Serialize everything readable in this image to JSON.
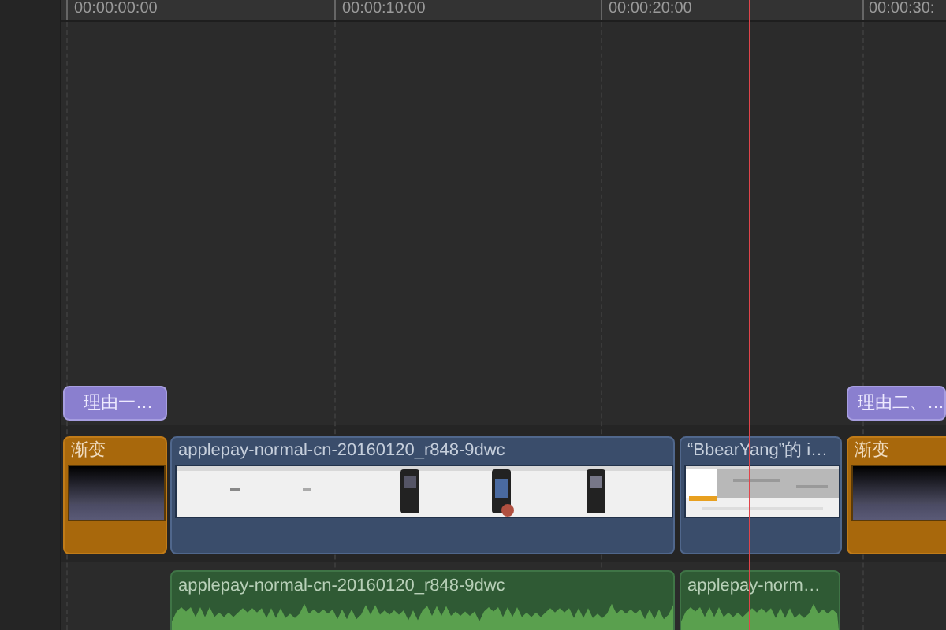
{
  "ruler": {
    "ticks": [
      "00:00:00:00",
      "00:00:10:00",
      "00:00:20:00",
      "00:00:30:"
    ]
  },
  "title_clips": [
    {
      "label": "理由一…"
    },
    {
      "label": "理由二、…"
    }
  ],
  "video_clips": [
    {
      "kind": "transition",
      "label": "渐变"
    },
    {
      "kind": "video",
      "label": "applepay-normal-cn-20160120_r848-9dwc"
    },
    {
      "kind": "video",
      "label": "“BbearYang”的 i…"
    },
    {
      "kind": "transition",
      "label": "渐变"
    }
  ],
  "audio_clips": [
    {
      "label": "applepay-normal-cn-20160120_r848-9dwc"
    },
    {
      "label": "applepay-norm…"
    }
  ]
}
